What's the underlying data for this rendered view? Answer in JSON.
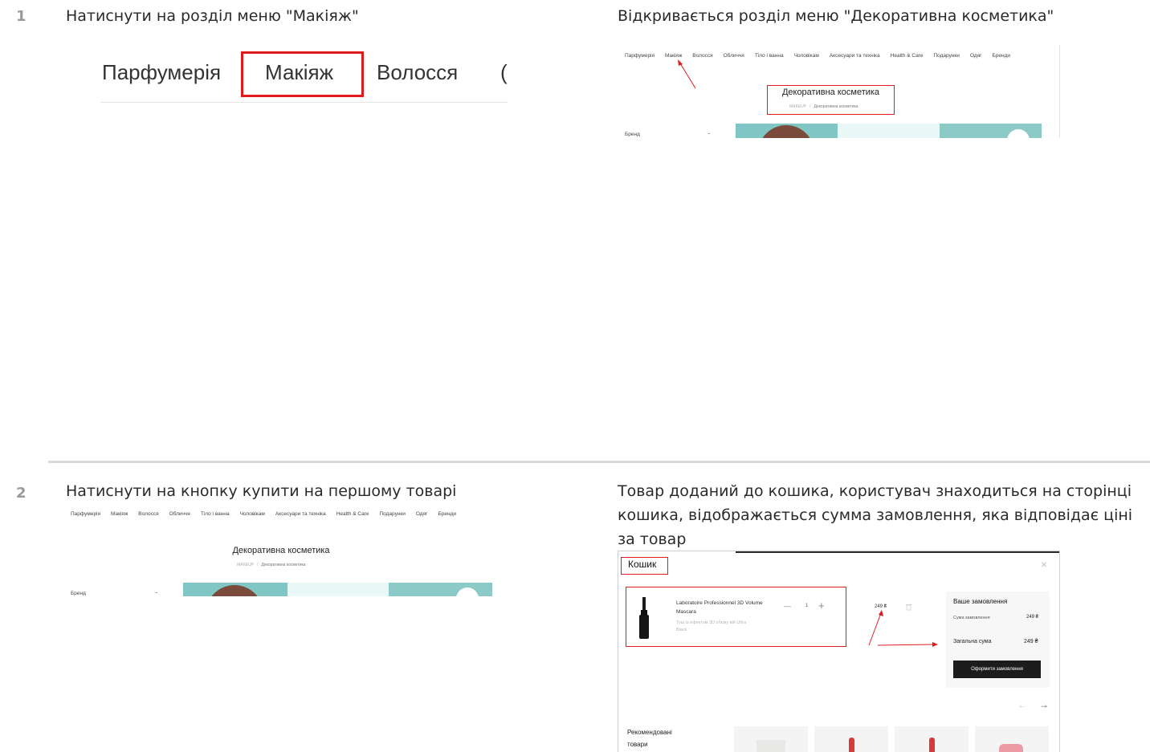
{
  "steps": [
    {
      "number": "1",
      "action": "Натиснути на розділ меню \"Макіяж\"",
      "result": "Відкривається розділ  меню \"Декоративна косметика\""
    },
    {
      "number": "2",
      "action": "Натиснути на кнопку купити на першому товарі",
      "result": "Товар доданий до кошика, користувач знаходиться на сторінці кошика, відображається сумма замовлення, яка відповідає ціні за товар"
    }
  ],
  "big_nav": {
    "items": [
      "Парфумерія",
      "Макіяж",
      "Волосся",
      "("
    ]
  },
  "site_nav": {
    "items": [
      "Парфумерія",
      "Макіяж",
      "Волосся",
      "Обличчя",
      "Тіло і ванна",
      "Чоловікам",
      "Аксесуари та техніка",
      "Health & Care",
      "Подарунки",
      "Одяг",
      "Бренди"
    ]
  },
  "category": {
    "title": "Декоративна косметика",
    "breadcrumb_root": "MAKEUP",
    "breadcrumb_sep": "/",
    "breadcrumb_current": "Декоративна косметика",
    "filter_label": "Бренд",
    "filter_toggle": "–"
  },
  "cart": {
    "title": "Кошик",
    "close_glyph": "×",
    "product_name": "Laboratoire Professionnel 3D Volume Mascara",
    "product_desc": "Туш із ефектом 3D обєму вій Ultra Black",
    "qty_minus": "—",
    "qty_value": "1",
    "qty_plus": "+",
    "item_price": "249 ₴",
    "summary_title": "Ваше замовлення",
    "subtotal_label": "Сума замовлення",
    "subtotal_value": "249 ₴",
    "total_label": "Загальна сума",
    "total_value": "249 ₴",
    "checkout_label": "Оформити замовлення",
    "arrow_prev": "←",
    "arrow_next": "→",
    "recommended_title": "Рекомендовані товари"
  },
  "colors": {
    "highlight": "#e01b1b",
    "banner_teal": "#7fc6c4",
    "banner_light": "#e9f7f6",
    "checkout_bg": "#1c1c1c"
  }
}
